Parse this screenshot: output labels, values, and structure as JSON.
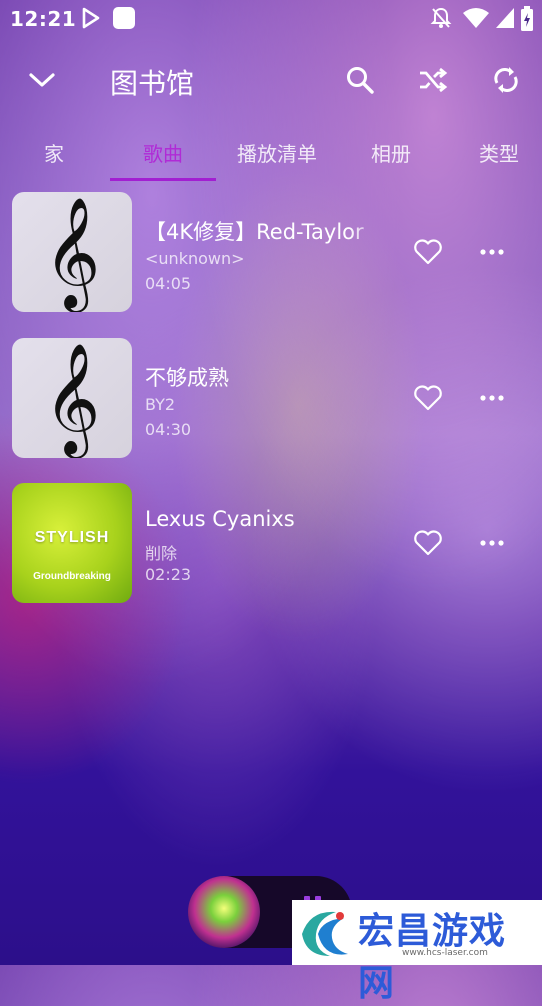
{
  "status_bar": {
    "time": "12:21",
    "icons": [
      "play-icon",
      "notification-app-icon",
      "notifications-off-icon",
      "wifi-icon",
      "cellular-signal-icon",
      "battery-icon"
    ]
  },
  "header": {
    "title": "图书馆",
    "icons": [
      "chevron-down-icon",
      "search-icon",
      "shuffle-icon",
      "refresh-icon"
    ]
  },
  "tabs": [
    {
      "label": "家",
      "active": false
    },
    {
      "label": "歌曲",
      "active": true
    },
    {
      "label": "播放清单",
      "active": false
    },
    {
      "label": "相册",
      "active": false
    },
    {
      "label": "类型",
      "active": false
    }
  ],
  "songs": [
    {
      "title": "【4K修复】Red-Taylor",
      "artist": "<unknown>",
      "duration": "04:05",
      "art": "treble-clef-icon"
    },
    {
      "title": "不够成熟",
      "artist": "BY2",
      "duration": "04:30",
      "art": "treble-clef-icon"
    },
    {
      "title": "Lexus Cyanixs",
      "artist": "削除",
      "duration": "02:23",
      "art": "stylish-cover",
      "art_text": "STYLISH",
      "art_subtext": "Groundbreaking"
    }
  ],
  "watermark": {
    "text": "宏昌游戏网",
    "url": "www.hcs-laser.com"
  },
  "colors": {
    "accent": "#a21fd1",
    "background_dark": "#2c0f8a"
  }
}
